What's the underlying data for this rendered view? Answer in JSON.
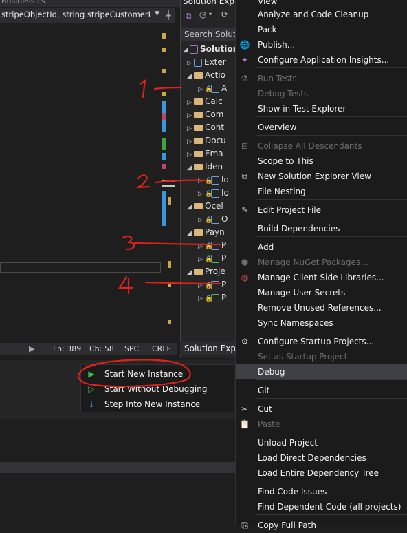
{
  "editor": {
    "tab_label": "Business.cs",
    "signature_text": "stripeObjectId, string stripeCustomerId, stri",
    "status": {
      "ln": "Ln: 389",
      "ch": "Ch: 58",
      "spc": "SPC",
      "crlf": "CRLF"
    }
  },
  "solution_explorer": {
    "title": "Solution Explo",
    "search_placeholder": "Search Solution",
    "bottom_tab": "Solution Explo",
    "root_label": "Solution",
    "nodes": [
      "Exter",
      "Actio",
      "A",
      "Calc",
      "Com",
      "Cont",
      "Docu",
      "Ema",
      "Iden",
      "Io",
      "Io",
      "Ocel",
      "O",
      "Payn",
      "P",
      "P",
      "Proje",
      "P",
      "P"
    ]
  },
  "context_menu": {
    "items": [
      {
        "label": "View",
        "icon": ""
      },
      {
        "label": "Analyze and Code Cleanup",
        "icon": ""
      },
      {
        "label": "Pack",
        "icon": ""
      },
      {
        "label": "Publish...",
        "icon": "globe-icon"
      },
      {
        "label": "Configure Application Insights...",
        "icon": "lightbulb-icon"
      },
      {
        "label": "Run Tests",
        "icon": "flask-icon",
        "disabled": true
      },
      {
        "label": "Debug Tests",
        "icon": "",
        "disabled": true
      },
      {
        "label": "Show in Test Explorer",
        "icon": ""
      },
      {
        "label": "Overview",
        "icon": ""
      },
      {
        "label": "Collapse All Descendants",
        "icon": "collapse-icon",
        "disabled": true
      },
      {
        "label": "Scope to This",
        "icon": ""
      },
      {
        "label": "New Solution Explorer View",
        "icon": "new-view-icon"
      },
      {
        "label": "File Nesting",
        "icon": ""
      },
      {
        "label": "Edit Project File",
        "icon": "edit-file-icon"
      },
      {
        "label": "Build Dependencies",
        "icon": ""
      },
      {
        "label": "Add",
        "icon": ""
      },
      {
        "label": "Manage NuGet Packages...",
        "icon": "nuget-icon",
        "disabled": true
      },
      {
        "label": "Manage Client-Side Libraries...",
        "icon": "library-globe-icon"
      },
      {
        "label": "Manage User Secrets",
        "icon": ""
      },
      {
        "label": "Remove Unused References...",
        "icon": ""
      },
      {
        "label": "Sync Namespaces",
        "icon": ""
      },
      {
        "label": "Configure Startup Projects...",
        "icon": "gear-icon"
      },
      {
        "label": "Set as Startup Project",
        "icon": "",
        "disabled": true
      },
      {
        "label": "Debug",
        "icon": "",
        "highlighted": true
      },
      {
        "label": "Git",
        "icon": ""
      },
      {
        "label": "Cut",
        "icon": "scissors-icon"
      },
      {
        "label": "Paste",
        "icon": "paste-icon",
        "disabled": true
      },
      {
        "label": "Unload Project",
        "icon": ""
      },
      {
        "label": "Load Direct Dependencies",
        "icon": ""
      },
      {
        "label": "Load Entire Dependency Tree",
        "icon": ""
      },
      {
        "label": "Find Code Issues",
        "icon": ""
      },
      {
        "label": "Find Dependent Code (all projects)",
        "icon": ""
      },
      {
        "label": "Copy Full Path",
        "icon": "copy-icon"
      }
    ]
  },
  "debug_submenu": {
    "items": [
      {
        "label": "Start New Instance",
        "icon": "play-icon"
      },
      {
        "label": "Start Without Debugging",
        "icon": "play-outline-icon"
      },
      {
        "label": "Step Into New Instance",
        "icon": "step-into-icon"
      }
    ]
  },
  "annotations": {
    "numbers": [
      "1",
      "2",
      "3",
      "4"
    ]
  },
  "colors": {
    "accent": "#3f3f46",
    "annotation_red": "#e0201a",
    "play_green": "#3fbf3f"
  }
}
